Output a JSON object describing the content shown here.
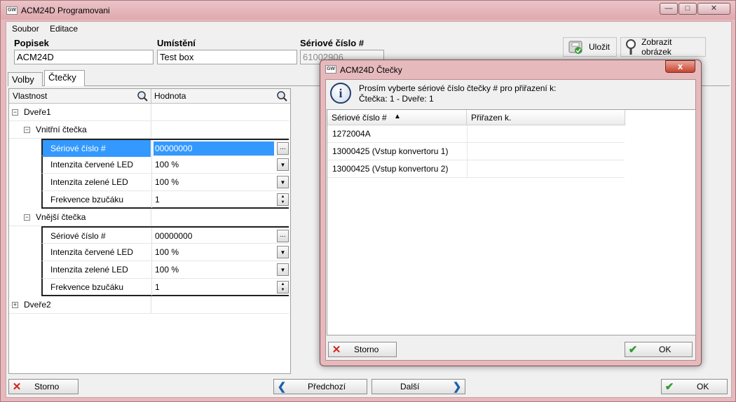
{
  "window": {
    "title": "ACM24D Programovani",
    "app_icon": "GW",
    "minimize": "—",
    "maximize": "□",
    "close": "✕"
  },
  "menu": [
    {
      "label": "Soubor"
    },
    {
      "label": "Editace"
    }
  ],
  "fields": {
    "popisek": {
      "label": "Popisek",
      "value": "ACM24D"
    },
    "umisteni": {
      "label": "Umístění",
      "value": "Test box"
    },
    "seriove": {
      "label": "Sériové číslo #",
      "value": "61002906"
    }
  },
  "toolbar": {
    "save_label": "Uložit",
    "show_image_label": "Zobrazit obrázek"
  },
  "tabs": [
    {
      "label": "Volby"
    },
    {
      "label": "Čtečky"
    }
  ],
  "grid": {
    "headers": {
      "property": "Vlastnost",
      "value": "Hodnota"
    },
    "rows": [
      {
        "label": "Dveře1",
        "value": ""
      },
      {
        "label": "Vnitřní čtečka",
        "value": ""
      },
      {
        "label": "Sériové číslo #",
        "value": "00000000"
      },
      {
        "label": "Intenzita červené LED",
        "value": "100 %"
      },
      {
        "label": "Intenzita zelené LED",
        "value": "100 %"
      },
      {
        "label": "Frekvence bzučáku",
        "value": "1"
      },
      {
        "label": "Vnější čtečka",
        "value": ""
      },
      {
        "label": "Sériové číslo #",
        "value": "00000000"
      },
      {
        "label": "Intenzita červené LED",
        "value": "100 %"
      },
      {
        "label": "Intenzita zelené LED",
        "value": "100 %"
      },
      {
        "label": "Frekvence bzučáku",
        "value": "1"
      },
      {
        "label": "Dveře2",
        "value": ""
      }
    ],
    "ellipsis": "..."
  },
  "bottom": {
    "cancel": "Storno",
    "prev": "Předchozí",
    "next": "Další",
    "ok": "OK"
  },
  "dialog": {
    "title": "ACM24D  Čtečky",
    "close": "x",
    "message_line1": "Prosím vyberte sériové číslo čtečky # pro přiřazení k:",
    "message_line2": "Čtečka: 1 - Dveře: 1",
    "columns": {
      "serial": "Sériové číslo #",
      "sort_indicator": "▲",
      "assigned": "Přiřazen k."
    },
    "items": [
      {
        "serial": "1272004A",
        "assigned": ""
      },
      {
        "serial": "13000425 (Vstup konvertoru 1)",
        "assigned": ""
      },
      {
        "serial": "13000425 (Vstup konvertoru 2)",
        "assigned": ""
      }
    ],
    "cancel": "Storno",
    "ok": "OK"
  },
  "colors": {
    "accent_red": "#d0231d",
    "ok_green": "#2f9a2f",
    "nav_blue": "#1b5fae",
    "selection": "#3399ff"
  }
}
